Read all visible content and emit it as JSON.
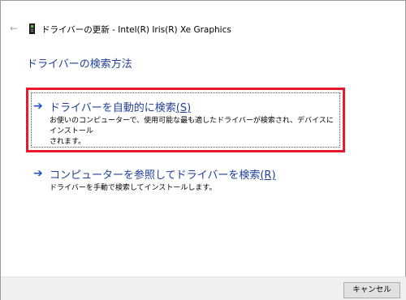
{
  "window": {
    "title": "ドライバーの更新 - Intel(R) Iris(R) Xe Graphics"
  },
  "heading": "ドライバーの検索方法",
  "options": [
    {
      "title": "ドライバーを自動的に検索",
      "accelerator": "(S)",
      "description_line1": "お使いのコンピューターで、使用可能な最も適したドライバーが検索され、デバイスにインストール",
      "description_line2": "されます。",
      "selected": true
    },
    {
      "title": "コンピューターを参照してドライバーを検索",
      "accelerator": "(R)",
      "description_line1": "ドライバーを手動で検索してインストールします。"
    }
  ],
  "footer": {
    "cancel_label": "キャンセル"
  },
  "colors": {
    "heading": "#1f3f9a",
    "arrow": "#1e50c8",
    "highlight": "#e8192c"
  },
  "icons": {
    "back": "back-arrow-icon",
    "device": "display-adapter-icon",
    "option_arrow": "right-arrow-icon"
  }
}
